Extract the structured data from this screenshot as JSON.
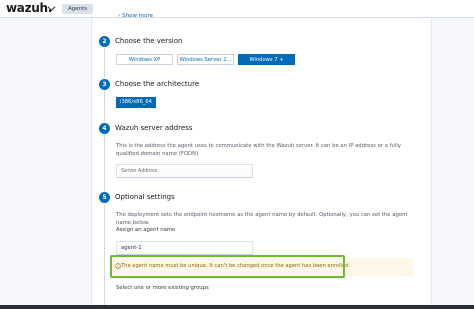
{
  "header": {
    "logo_text": "wazuh.",
    "breadcrumb": "Agents"
  },
  "top": {
    "show_more": "Show more"
  },
  "steps": [
    {
      "number": "2",
      "title": "Choose the version"
    },
    {
      "number": "3",
      "title": "Choose the architecture"
    },
    {
      "number": "4",
      "title": "Wazuh server address"
    },
    {
      "number": "5",
      "title": "Optional settings"
    }
  ],
  "version_options": [
    "Windows XP",
    "Windows Server 2...",
    "Windows 7 +"
  ],
  "version_selected": "Windows 7 +",
  "architecture": {
    "selected": "i386/x86_64"
  },
  "server": {
    "description": "This is the address the agent uses to communicate with the Wazuh server. It can be an IP address or a fully qualified domain name (FQDN).",
    "placeholder": "Server Address"
  },
  "optional": {
    "description": "The deployment sets the endpoint hostname as the agent name by default. Optionally, you can set the agent name below.",
    "agent_name_label": "Assign an agent name",
    "agent_name_value": "agent-1",
    "callout_text": "The agent name must be unique. It can't be changed once the agent has been enrolled.",
    "groups_label": "Select one or more existing groups"
  },
  "colors": {
    "accent": "#006bb8",
    "highlight": "#6dbd2c",
    "callout_bg": "#fef6e6"
  }
}
